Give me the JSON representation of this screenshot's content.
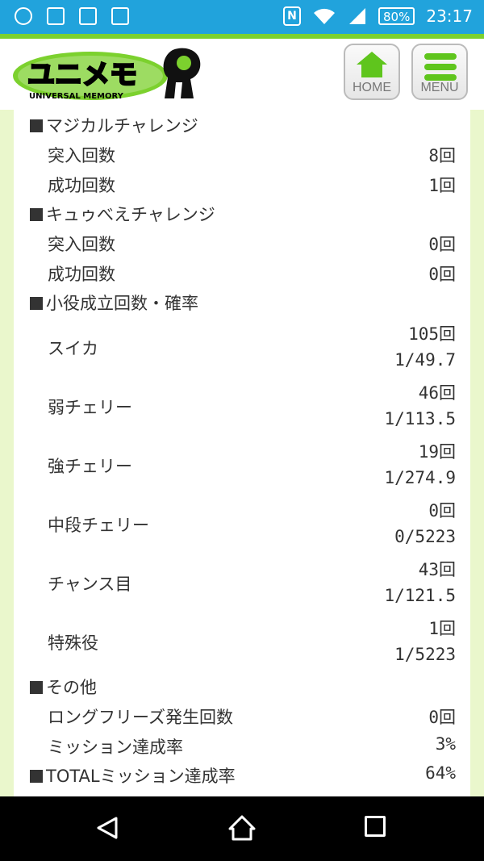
{
  "status_bar": {
    "icons_left": [
      "mail-icon",
      "image-icon",
      "calendar-icon",
      "gmail-icon"
    ],
    "nfc": "N",
    "battery": "80%",
    "time": "23:17"
  },
  "header": {
    "logo_text": "ユニメモ",
    "logo_subtext": "UNIVERSAL MEMORY",
    "home_label": "HOME",
    "menu_label": "MENU",
    "accent": "#5fc51d"
  },
  "stats": {
    "magical": {
      "title": "マジカルチャレンジ",
      "rows": [
        {
          "label": "突入回数",
          "value": "8回"
        },
        {
          "label": "成功回数",
          "value": "1回"
        }
      ]
    },
    "kyubey": {
      "title": "キュゥべえチャレンジ",
      "rows": [
        {
          "label": "突入回数",
          "value": "0回"
        },
        {
          "label": "成功回数",
          "value": "0回"
        }
      ]
    },
    "koyaku": {
      "title": "小役成立回数・確率",
      "rows": [
        {
          "label": "スイカ",
          "count": "105回",
          "rate": "1/49.7"
        },
        {
          "label": "弱チェリー",
          "count": "46回",
          "rate": "1/113.5"
        },
        {
          "label": "強チェリー",
          "count": "19回",
          "rate": "1/274.9"
        },
        {
          "label": "中段チェリー",
          "count": "0回",
          "rate": "0/5223"
        },
        {
          "label": "チャンス目",
          "count": "43回",
          "rate": "1/121.5"
        },
        {
          "label": "特殊役",
          "count": "1回",
          "rate": "1/5223"
        }
      ]
    },
    "other": {
      "title": "その他",
      "rows": [
        {
          "label": "ロングフリーズ発生回数",
          "value": "0回"
        },
        {
          "label": "ミッション達成率",
          "value": "3%"
        }
      ]
    },
    "total": {
      "label": "TOTALミッション達成率",
      "value": "64%"
    }
  }
}
